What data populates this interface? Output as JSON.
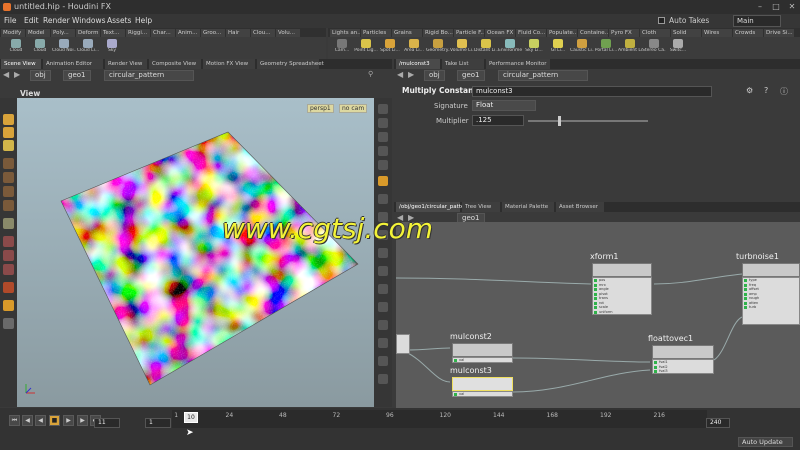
{
  "window": {
    "title": "untitled.hip - Houdini FX"
  },
  "menu": [
    "File",
    "Edit",
    "Render",
    "Windows",
    "Assets",
    "Help"
  ],
  "auto_takes": "Auto Takes",
  "desktop": "Main",
  "shelf_tabs_left": [
    "Create",
    "Modify",
    "Model",
    "Poly...",
    "Deform",
    "Text...",
    "Riggi...",
    "Char...",
    "Anim...",
    "Groo...",
    "Hair",
    "Clou...",
    "Volu..."
  ],
  "shelf_tabs_right": [
    "Lights an...",
    "Particles",
    "Grains",
    "Rigid Bo...",
    "Particle F...",
    "Ocean FX",
    "Fluid Co...",
    "Populate...",
    "Containe...",
    "Pyro FX",
    "Cloth",
    "Solid",
    "Wires",
    "Crowds",
    "Drive Si..."
  ],
  "shelf_tools_left": [
    "Cloud",
    "Cloud",
    "Cloud Noi...",
    "Cloud Li...",
    "Sky"
  ],
  "shelf_tools_right": [
    "Cam...",
    "Point Lig...",
    "Spot Li...",
    "Area Li...",
    "Geometry...",
    "Volume Li...",
    "Distant Li...",
    "Environme...",
    "Sky Li...",
    "GI Li...",
    "Caustic Li...",
    "Portal Li...",
    "Ambient Li...",
    "Stereo Ca...",
    "Switc..."
  ],
  "left_pane_tabs": [
    "Scene View",
    "Animation Editor",
    "Render View",
    "Composite View",
    "Motion FX View",
    "Geometry Spreadsheet"
  ],
  "left_path": {
    "obj": "obj",
    "geo": "geo1",
    "node": "circular_pattern"
  },
  "view_label": "View",
  "camera_menus": {
    "persp": "persp1",
    "cam": "no cam"
  },
  "right_pane_tabs": [
    "/mulconst3",
    "Take List",
    "Performance Monitor"
  ],
  "right_path": {
    "obj": "obj",
    "geo": "geo1",
    "node": "circular_pattern"
  },
  "params": {
    "node_type": "Multiply Constant",
    "node_name": "mulconst3",
    "signature_label": "Signature",
    "signature_value": "Float",
    "multiplier_label": "Multiplier",
    "multiplier_value": ".125",
    "slider_fraction": 0.25
  },
  "network_tabs": [
    "/obj/geo1/circular_pattern",
    "Tree View",
    "Material Palette",
    "Asset Browser"
  ],
  "network_path": {
    "geo": "geo1"
  },
  "nodes": {
    "xform": {
      "name": "xform1",
      "ports": [
        "pos",
        "mrx",
        "angle",
        "pivot",
        "trans",
        "rot",
        "scale",
        "uniform"
      ]
    },
    "turbnoise": {
      "name": "turbnoise1",
      "ports": [
        "type",
        "freq",
        "offset",
        "amp",
        "rough",
        "atten",
        "turb"
      ]
    },
    "mulconst2": {
      "name": "mulconst2",
      "ports": [
        "val"
      ]
    },
    "mulconst3": {
      "name": "mulconst3",
      "ports": [
        "val"
      ]
    },
    "floattovec": {
      "name": "floattovec1",
      "ports": [
        "fval1",
        "fval2",
        "fval3"
      ]
    }
  },
  "timeline": {
    "start_frame": "11",
    "step": "1",
    "current_frame": "10",
    "ticks": [
      "1",
      "24",
      "48",
      "72",
      "96",
      "120",
      "144",
      "168",
      "192",
      "216"
    ],
    "end_frame": "240",
    "auto_update": "Auto Update"
  },
  "watermark": "www.cgtsj.com"
}
